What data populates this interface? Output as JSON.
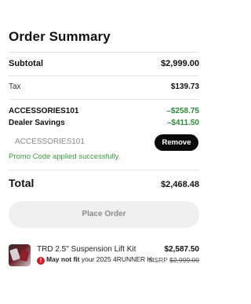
{
  "summary": {
    "title": "Order Summary",
    "subtotal_label": "Subtotal",
    "subtotal_value": "$2,999.00",
    "tax_label": "Tax",
    "tax_value": "$139.73",
    "promo_code_label": "ACCESSORIES101",
    "promo_code_value": "–$258.75",
    "dealer_savings_label": "Dealer Savings",
    "dealer_savings_value": "–$411.50",
    "promo_input_value": "ACCESSORIES101",
    "remove_label": "Remove",
    "promo_success": "Promo Code applied successfully.",
    "total_label": "Total",
    "total_value": "$2,468.48",
    "place_order_label": "Place Order"
  },
  "item": {
    "name": "TRD 2.5\" Suspension Lift Kit",
    "warning_bold": "May not fit",
    "warning_text": " your 2025 4RUNNER H...",
    "price": "$2,587.50",
    "msrp_label": "MSRP ",
    "msrp_value": "$2,999.00",
    "warning_icon": "alert-circle-icon"
  },
  "colors": {
    "green": "#2e8b3a",
    "button_dark": "#0b0b0b",
    "disabled_button": "#efefef",
    "warning_red": "#d0202b"
  }
}
